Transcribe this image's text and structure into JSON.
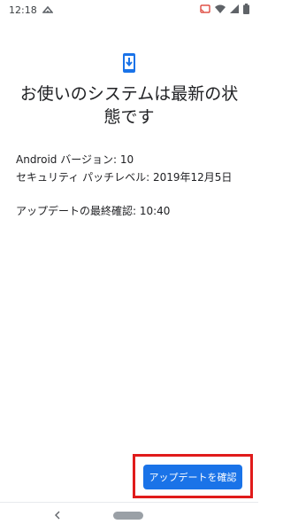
{
  "status_bar": {
    "time": "12:18",
    "icons": [
      "cloud-icon",
      "cast-icon",
      "wifi-icon",
      "signal-icon",
      "battery-icon"
    ]
  },
  "header": {
    "icon": "phone-download-icon",
    "title": "お使いのシステムは最新の状態です"
  },
  "info": {
    "android_version": "Android バージョン: 10",
    "security_patch": "セキュリティ パッチレベル: 2019年12月5日",
    "last_checked": "アップデートの最終確認: 10:40"
  },
  "actions": {
    "check_update_label": "アップデートを確認"
  },
  "colors": {
    "accent": "#1a73e8",
    "highlight": "#e01b1b"
  }
}
